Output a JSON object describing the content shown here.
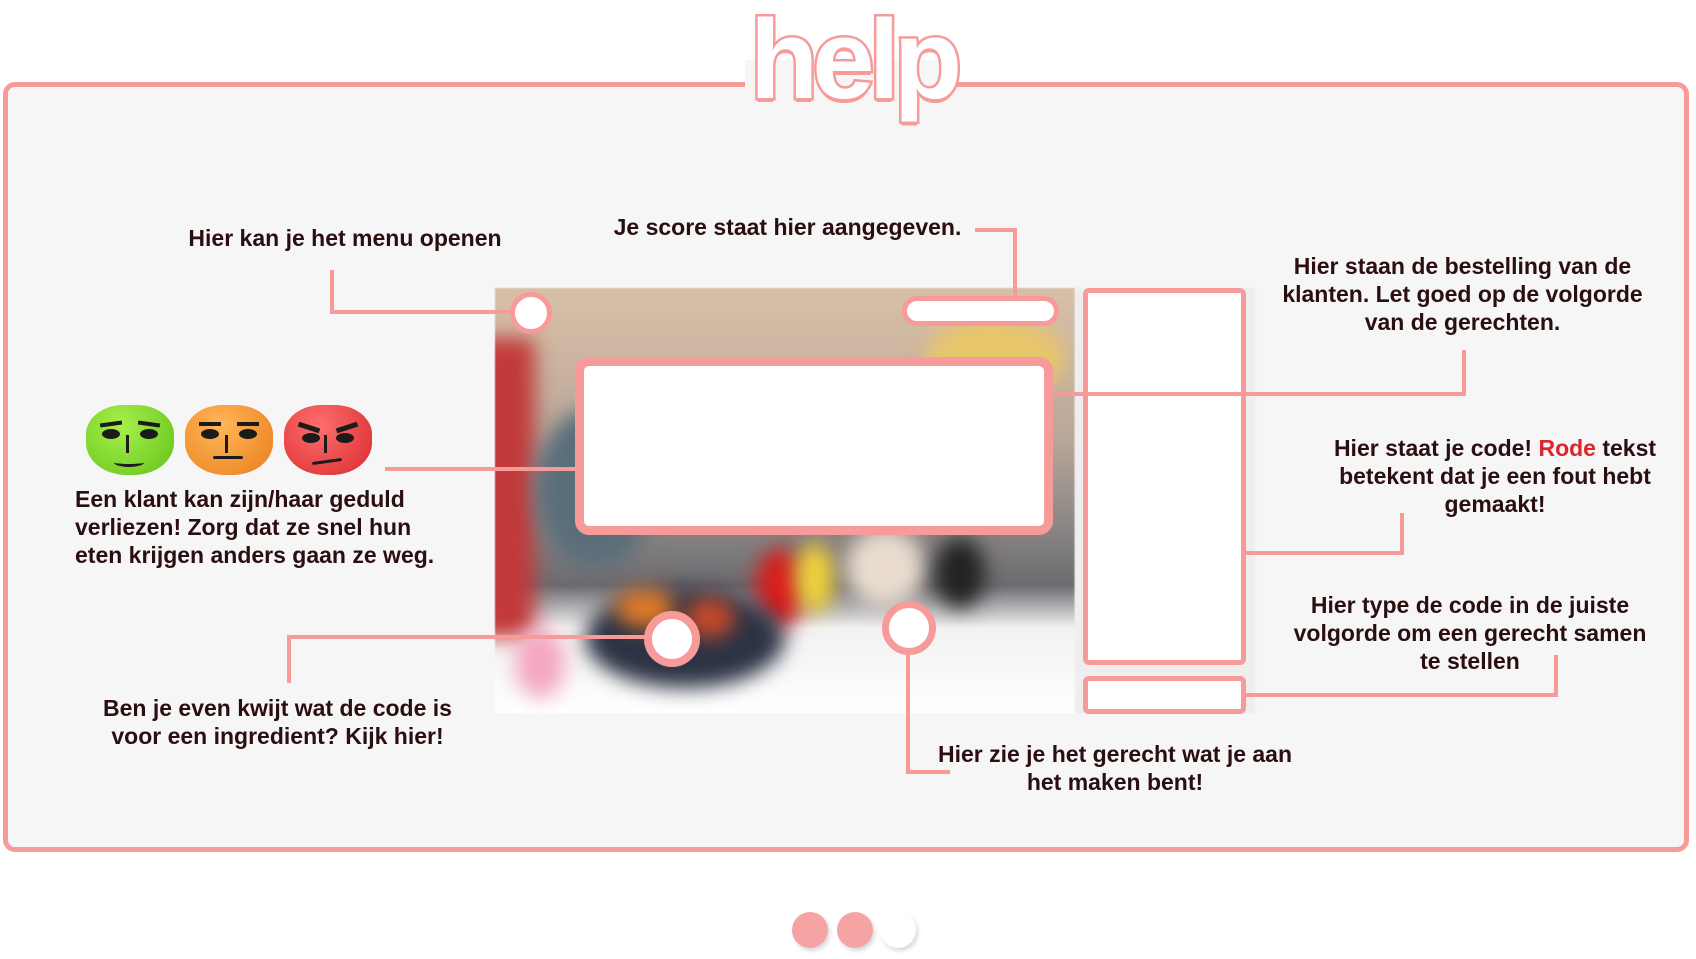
{
  "title": "help",
  "labels": {
    "menu": "Hier kan je het menu openen",
    "score": "Je score staat hier aangegeven.",
    "orders": "Hier staan de bestelling van de klanten. Let goed op de volgorde van de gerechten.",
    "patience": "Een klant kan zijn/haar geduld verliezen! Zorg dat ze snel hun eten krijgen anders gaan ze weg.",
    "code_prefix": "Hier staat je code!",
    "code_red": "Rode",
    "code_suffix": "tekst betekent dat je een fout hebt gemaakt!",
    "type_code": "Hier type de code in de juiste volgorde om een gerecht samen te stellen",
    "ingredients": "Ben je even kwijt wat de code is voor een ingredient? Kijk hier!",
    "dish": "Hier zie je het gerecht wat je aan het maken bent!"
  },
  "faces": [
    {
      "name": "happy-customer",
      "color": "#7ed321"
    },
    {
      "name": "neutral-customer",
      "color": "#f5922a"
    },
    {
      "name": "angry-customer",
      "color": "#ec4548"
    }
  ],
  "pager": {
    "pages": 3,
    "current": 3,
    "colors": {
      "filled": "#f5a3a3",
      "empty": "#ffffff"
    }
  },
  "colors": {
    "accent": "#f79a9a",
    "panel": "#f6f6f6",
    "error": "#e0242b"
  }
}
